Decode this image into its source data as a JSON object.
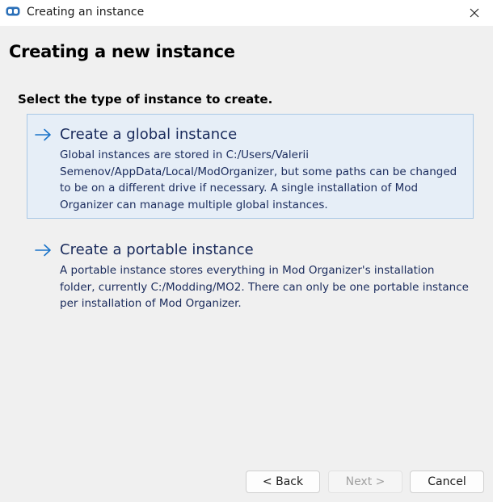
{
  "window": {
    "title": "Creating an instance"
  },
  "page": {
    "title": "Creating a new instance",
    "subtitle": "Select the type of instance to create."
  },
  "options": [
    {
      "title": "Create a global instance",
      "description": "Global instances are stored in C:/Users/Valerii Semenov/AppData/Local/ModOrganizer, but some paths can be changed to be on a different drive if necessary. A single installation of Mod Organizer can manage multiple global instances."
    },
    {
      "title": "Create a portable instance",
      "description": "A portable instance stores everything in Mod Organizer's installation folder, currently C:/Modding/MO2. There can only be one portable instance per installation of Mod Organizer."
    }
  ],
  "buttons": {
    "back": "< Back",
    "next": "Next >",
    "cancel": "Cancel"
  },
  "colors": {
    "accent": "#1a73c9",
    "option_text": "#1a2b5c",
    "hover_border": "#a8c8e6",
    "hover_background": "#e6eef7"
  },
  "icons": {
    "app": "mod-organizer-icon",
    "close": "close-icon",
    "option_arrow": "arrow-right-icon"
  }
}
